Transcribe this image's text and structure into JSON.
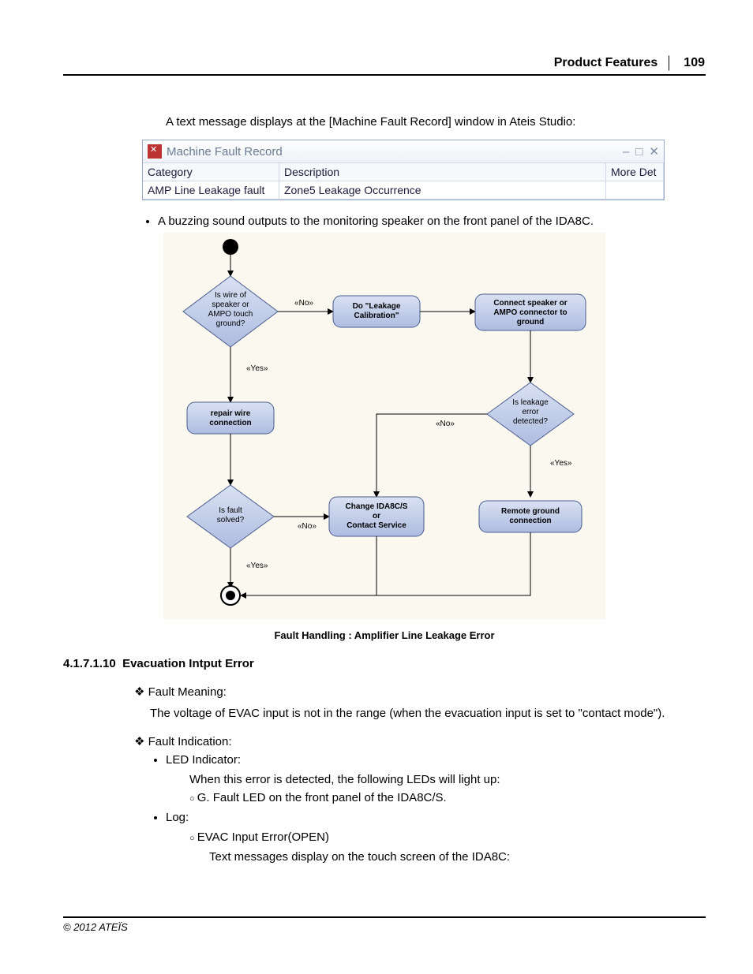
{
  "header": {
    "title": "Product Features",
    "page": "109"
  },
  "intro": "A text message displays at the [Machine Fault Record] window in Ateis Studio:",
  "mfr": {
    "win_title": "Machine Fault Record",
    "btn_min": "–",
    "btn_max": "□",
    "btn_close": "✕",
    "cols": {
      "c1": "Category",
      "c2": "Description",
      "c3": "More Det"
    },
    "row": {
      "c1": "AMP Line Leakage fault",
      "c2": "Zone5 Leakage Occurrence",
      "c3": ""
    }
  },
  "bullet1": "A buzzing sound outputs to the monitoring speaker on the front panel of the IDA8C.",
  "flow": {
    "d1": "Is wire of\nspeaker or\nAMPO touch\nground?",
    "p1": "Do \"Leakage\nCalibration\"",
    "p2": "Connect speaker or\nAMPO connector to\nground",
    "a1": "repair wire\nconnection",
    "d2": "Is leakage\nerror\ndetected?",
    "d3": "Is fault\nsolved?",
    "p3": "Change IDA8C/S\nor\nContact Service",
    "p4": "Remote ground\nconnection",
    "no": "«No»",
    "yes": "«Yes»",
    "caption": "Fault Handling : Amplifier Line Leakage Error"
  },
  "sec": {
    "num": "4.1.7.1.10",
    "title": "Evacuation Intput Error"
  },
  "fm": {
    "label": "Fault Meaning:",
    "text": "The voltage of EVAC input is not in the range (when the evacuation input is set to \"contact mode\")."
  },
  "fi": {
    "label": "Fault Indication:",
    "led": "LED Indicator:",
    "led_text": "When this error is detected, the following LEDs will light up:",
    "led_item": "G. Fault LED on the front panel of the IDA8C/S.",
    "log": "Log:",
    "log_item": "EVAC Input Error(OPEN)",
    "log_text": "Text messages display on the touch screen of the IDA8C:"
  },
  "footer": "© 2012 ATEÏS"
}
